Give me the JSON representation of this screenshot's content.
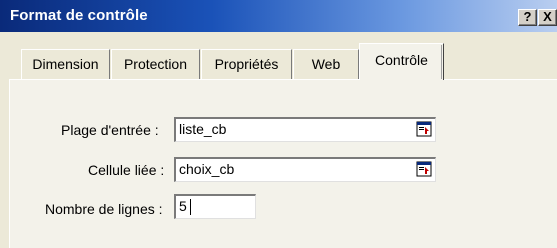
{
  "dialog": {
    "title": "Format de contrôle",
    "help_label": "?",
    "close_label": "X"
  },
  "tabs": [
    {
      "label": "Dimension",
      "active": false
    },
    {
      "label": "Protection",
      "active": false
    },
    {
      "label": "Propriétés",
      "active": false
    },
    {
      "label": "Web",
      "active": false
    },
    {
      "label": "Contrôle",
      "active": true
    }
  ],
  "form": {
    "input_range": {
      "label": "Plage d'entrée :",
      "value": "liste_cb"
    },
    "linked_cell": {
      "label": "Cellule liée :",
      "value": "choix_cb"
    },
    "line_count": {
      "label": "Nombre de lignes :",
      "value": "5"
    }
  },
  "icons": {
    "range_picker": "collapse-dialog-range-icon"
  },
  "colors": {
    "titlebar_start": "#0a2a7a",
    "titlebar_end": "#b9cef0",
    "panel_bg": "#f3f2ea",
    "dialog_bg": "#ece9d8"
  }
}
